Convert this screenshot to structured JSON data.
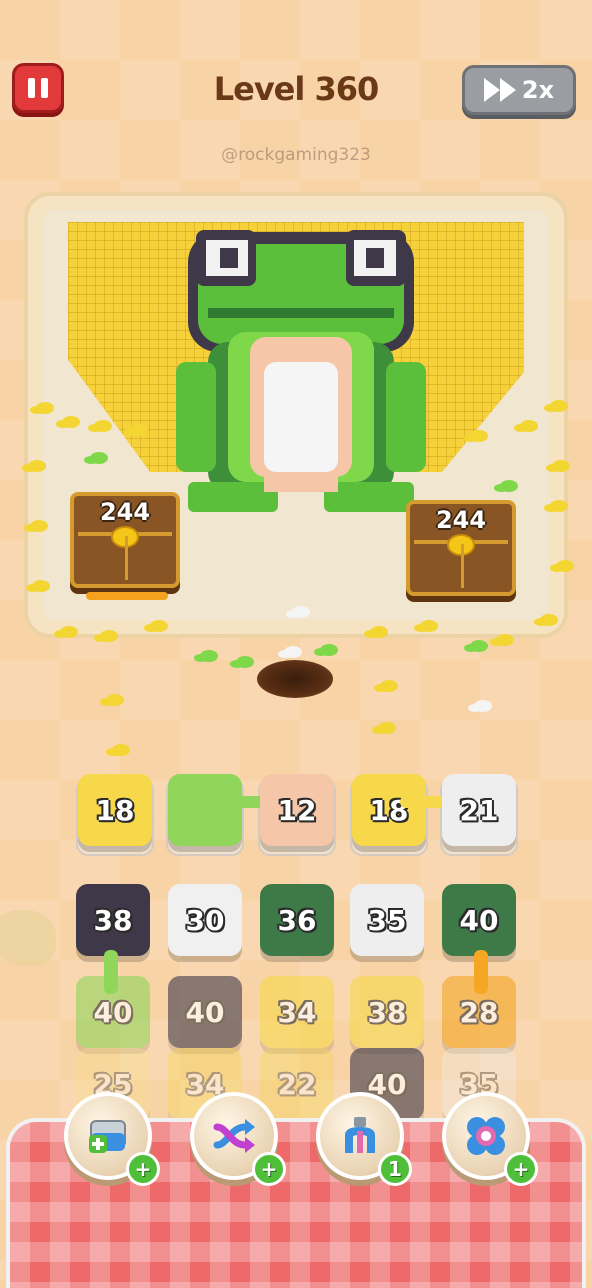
{
  "header": {
    "level_label": "Level 360",
    "watermark": "@rockgaming323",
    "speed_label": "2x",
    "colors": {
      "pause": "#e23a3a",
      "speed": "#9a9ea2"
    }
  },
  "board": {
    "chests": [
      {
        "value": "244"
      },
      {
        "value": "244"
      }
    ]
  },
  "queue_row": [
    {
      "value": "18",
      "color": "#f7d84a"
    },
    {
      "value": "",
      "color": "#8fd65a"
    },
    {
      "value": "12",
      "color": "#f6c6a8"
    },
    {
      "value": "18",
      "color": "#f7d84a"
    },
    {
      "value": "21",
      "color": "#eeeeee"
    }
  ],
  "grid": [
    [
      {
        "value": "38",
        "color": "#3f3848"
      },
      {
        "value": "30",
        "color": "#f0f0f0"
      },
      {
        "value": "36",
        "color": "#3e7a48"
      },
      {
        "value": "35",
        "color": "#eeeeee"
      },
      {
        "value": "40",
        "color": "#3e7a48"
      }
    ],
    [
      {
        "value": "40",
        "color": "#8fd65a"
      },
      {
        "value": "40",
        "color": "#3f3848"
      },
      {
        "value": "34",
        "color": "#f7d84a"
      },
      {
        "value": "38",
        "color": "#f7d84a"
      },
      {
        "value": "28",
        "color": "#f5a623"
      }
    ],
    [
      {
        "value": "25",
        "color": "#f7e08a"
      },
      {
        "value": "34",
        "color": "#f7d84a"
      },
      {
        "value": "22",
        "color": "#f7d84a"
      },
      {
        "value": "40",
        "color": "#3f3848"
      },
      {
        "value": "35",
        "color": "#eeeeee"
      }
    ]
  ],
  "boosters": [
    {
      "icon": "add-slot-icon",
      "badge": "+"
    },
    {
      "icon": "shuffle-icon",
      "badge": "+"
    },
    {
      "icon": "magnet-icon",
      "badge": "1"
    },
    {
      "icon": "swap-icon",
      "badge": "+"
    }
  ]
}
